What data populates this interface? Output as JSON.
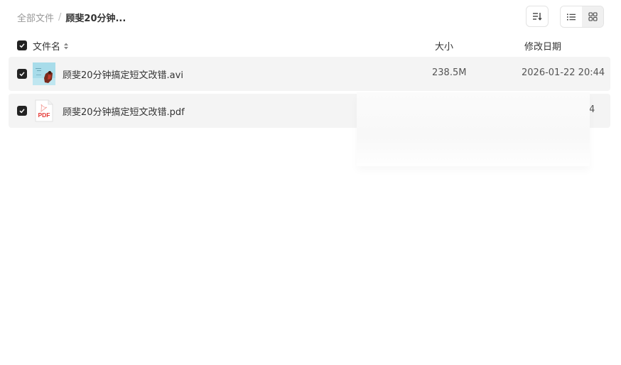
{
  "breadcrumb": {
    "root": "全部文件",
    "separator": "/",
    "current": "顾斐20分钟..."
  },
  "toolbar": {
    "sort_icon": "sort-icon",
    "list_view_icon": "list-view-icon",
    "grid_view_icon": "grid-view-icon"
  },
  "header": {
    "name": "文件名",
    "size": "大小",
    "date": "修改日期"
  },
  "files": [
    {
      "name": "顾斐20分钟搞定短文改错.avi",
      "size": "238.5M",
      "date": "2026-01-22 20:44",
      "type": "video"
    },
    {
      "name": "顾斐20分钟搞定短文改错.pdf",
      "size": "",
      "date": "4",
      "type": "pdf",
      "thumb_label": "PDF"
    }
  ],
  "colors": {
    "row_bg": "#f4f4f4",
    "checkbox": "#222222",
    "pdf_red": "#e53935"
  }
}
